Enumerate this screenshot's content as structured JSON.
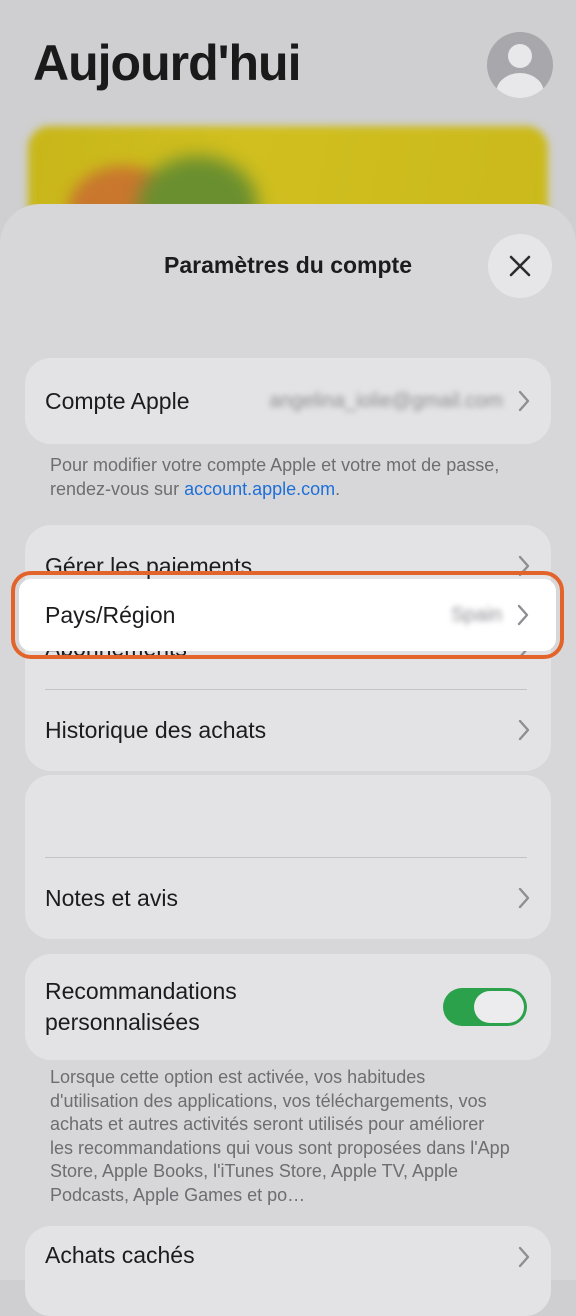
{
  "background": {
    "title": "Aujourd'hui",
    "avatar_icon": "person-circle-icon"
  },
  "sheet": {
    "title": "Paramètres du compte",
    "close_icon": "close-icon"
  },
  "apple_account": {
    "label": "Compte Apple",
    "value": "angelina_iolie@gmail.com",
    "note_prefix": "Pour modifier votre compte Apple et votre mot de passe, rendez-vous sur ",
    "note_link": "account.apple.com",
    "note_suffix": "."
  },
  "payments_group": {
    "items": [
      {
        "label": "Gérer les paiements"
      },
      {
        "label": "Abonnements"
      },
      {
        "label": "Historique des achats"
      }
    ]
  },
  "region_group": {
    "country_label": "Pays/Région",
    "country_value": "Spain",
    "ratings_label": "Notes et avis"
  },
  "recommendations": {
    "label": "Recommandations personnalisées",
    "toggle_on": true,
    "toggle_color": "#2aa14a",
    "note": "Lorsque cette option est activée, vos habitudes d'utilisation des applications, vos téléchargements, vos achats et autres activités seront utilisés pour améliorer les recommandations qui vous sont proposées dans l'App Store, Apple Books, l'iTunes Store, Apple TV, Apple Podcasts, Apple Games et po…"
  },
  "hidden_purchases": {
    "label": "Achats cachés"
  },
  "colors": {
    "highlight": "#e2642b",
    "link": "#1e6fd9"
  }
}
